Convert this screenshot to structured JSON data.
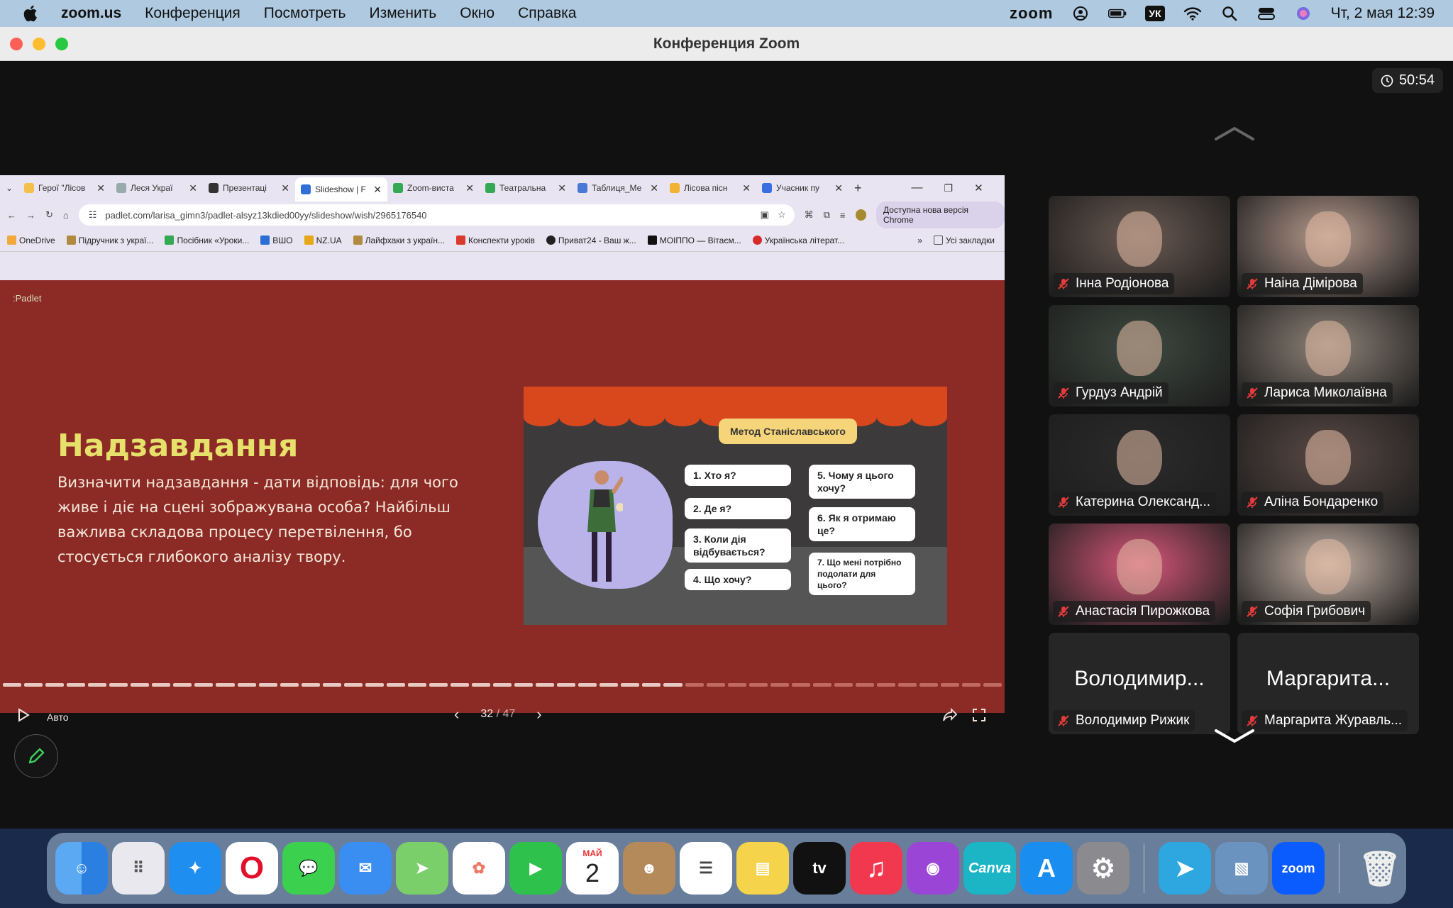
{
  "menubar": {
    "app": "zoom.us",
    "items": [
      "Конференция",
      "Посмотреть",
      "Изменить",
      "Окно",
      "Справка"
    ],
    "zoom_word": "zoom",
    "lang": "УК",
    "clock": "Чт, 2 мая  12:39"
  },
  "window": {
    "title": "Конференция Zoom",
    "timer": "50:54"
  },
  "browser": {
    "tabs": [
      "Герої \"Лісов",
      "Леся Украї",
      "Презентаці",
      "Slideshow | F",
      "Zoom-виста",
      "Театральна",
      "Таблиця_Ме",
      "Лісова пісн",
      "Учасник пу"
    ],
    "url": "padlet.com/larisa_gimn3/padlet-alsyz13kdied00yy/slideshow/wish/2965176540",
    "update_button": "Доступна нова версія Chrome",
    "bookmarks": [
      "OneDrive",
      "Підручник з украї...",
      "Посібник «Уроки...",
      "ВШО",
      "NZ.UA",
      "Лайфхаки з україн...",
      "Конспекти уроків",
      "Приват24 - Ваш ж...",
      "МОІППО — Вітаєм...",
      "Українська літерат..."
    ],
    "all_bookmarks": "Усі закладки"
  },
  "slide": {
    "brand": ":Padlet",
    "title": "Надзавдання",
    "body": "Визначити надзавдання - дати відповідь: для чого живе і діє на сцені зображувана особа? Найбільш важлива складова процесу перетвілення, бо стосується глибокого аналізу твору.",
    "image": {
      "method": "Метод Станіславського",
      "q1": "1. Хто я?",
      "q2": "2. Де я?",
      "q3": "3. Коли дія відбувається?",
      "q4": "4. Що хочу?",
      "q5": "5. Чому я цього хочу?",
      "q6": "6. Як я отримаю це?",
      "q7": "7. Що мені потрібно подолати для цього?"
    },
    "auto_label": "Авто",
    "current": "32",
    "total": "/ 47",
    "progress_current": 32,
    "progress_total": 47
  },
  "participants": [
    {
      "name": "Інна Родіонова",
      "photo": "#6b5a52"
    },
    {
      "name": "Наіна Дімірова",
      "photo": "#b79b8e"
    },
    {
      "name": "Гурдуз Андрій",
      "photo": "#3e4a40"
    },
    {
      "name": "Лариса Миколаївна",
      "photo": "#8f8378",
      "speaking": true
    },
    {
      "name": "Катерина Олександ...",
      "photo": "#2b2b2b"
    },
    {
      "name": "Аліна Бондаренко",
      "photo": "#5b4a45"
    },
    {
      "name": "Анастасія Пирожкова",
      "photo": "#d9577a"
    },
    {
      "name": "Софія Грибович",
      "photo": "#c7b3a6"
    },
    {
      "name": "Володимир Рижик",
      "big": "Володимир..."
    },
    {
      "name": "Маргарита Журавль...",
      "big": "Маргарита..."
    }
  ],
  "dock": {
    "calendar_month": "МАЙ",
    "calendar_day": "2",
    "apps": [
      "finder-icon",
      "launchpad-icon",
      "safari-icon",
      "opera-icon",
      "messages-icon",
      "mail-icon",
      "maps-icon",
      "photos-icon",
      "facetime-icon",
      "calendar-icon",
      "contacts-icon",
      "reminders-icon",
      "notes-icon",
      "apple-tv-icon",
      "music-icon",
      "podcasts-icon",
      "canva-icon",
      "app-store-icon",
      "system-settings-icon",
      "telegram-icon",
      "preview-icon",
      "zoom-icon",
      "trash-icon"
    ],
    "canva_label": "Canva",
    "tv_label": "tv",
    "zoom_label": "zoom"
  }
}
